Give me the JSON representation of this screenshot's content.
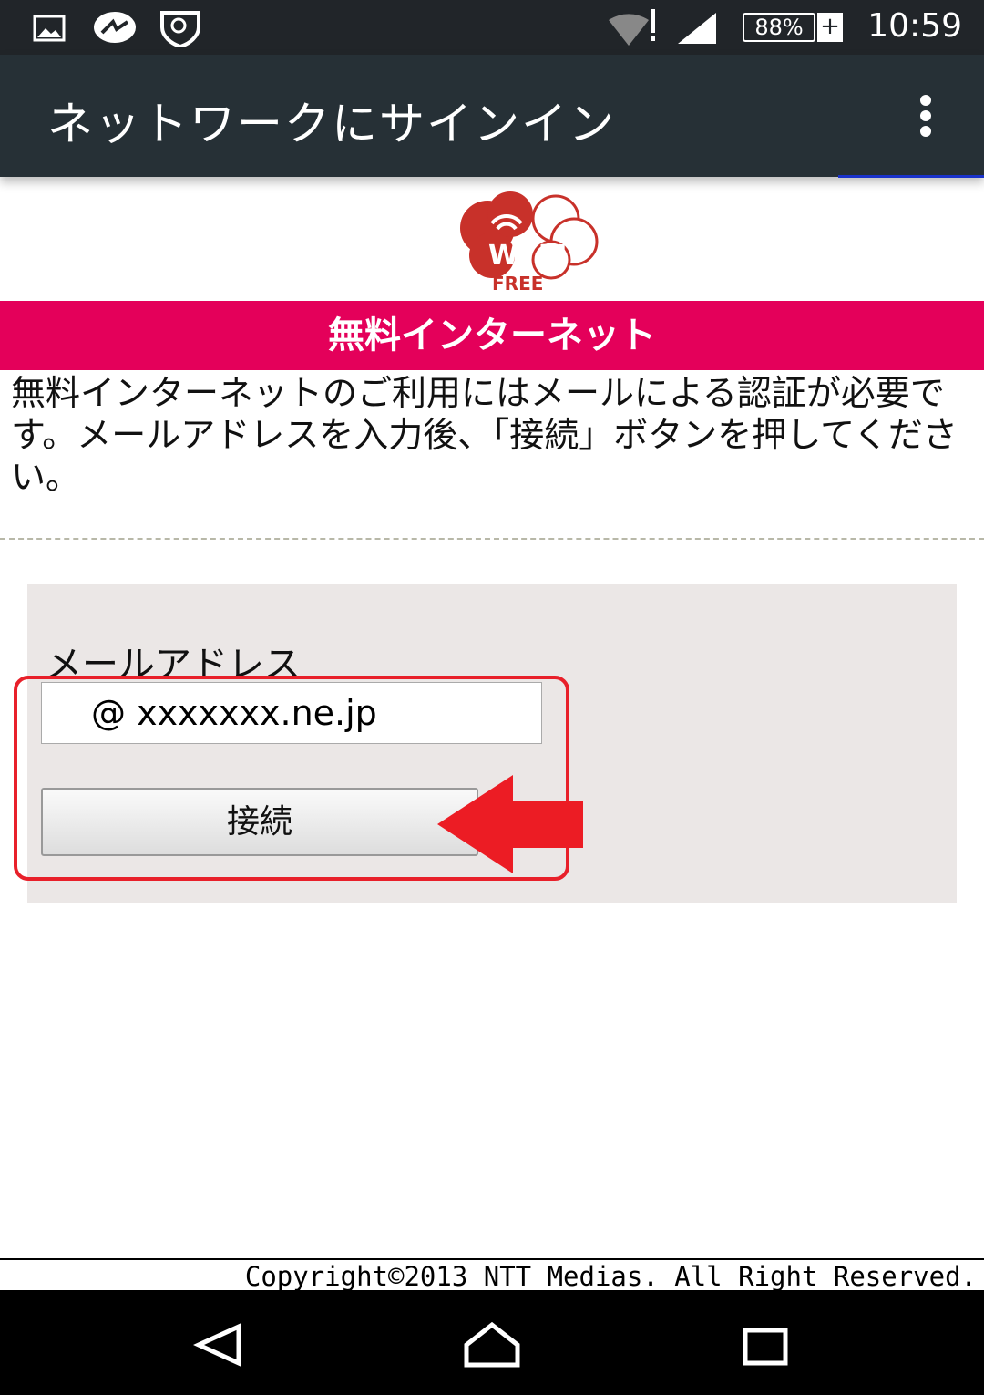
{
  "status_bar": {
    "battery": "88%",
    "battery_plus": "+",
    "time": "10:59"
  },
  "app_bar": {
    "title": "ネットワークにサインイン"
  },
  "logo": {
    "text": "WI FI",
    "sub": "FREE"
  },
  "banner": {
    "title": "無料インターネット"
  },
  "intro": {
    "text": "無料インターネットのご利用にはメールによる認証が必要です。メールアドレスを入力後、「接続」ボタンを押してください。"
  },
  "form": {
    "email_label": "メールアドレス",
    "email_value": "@ xxxxxxx.ne.jp",
    "connect_label": "接続"
  },
  "footer": {
    "copyright": "Copyright©2013 NTT Medias. All Right Reserved."
  },
  "colors": {
    "banner": "#e4005a",
    "highlight": "#e8202a",
    "appbar": "#263036"
  }
}
